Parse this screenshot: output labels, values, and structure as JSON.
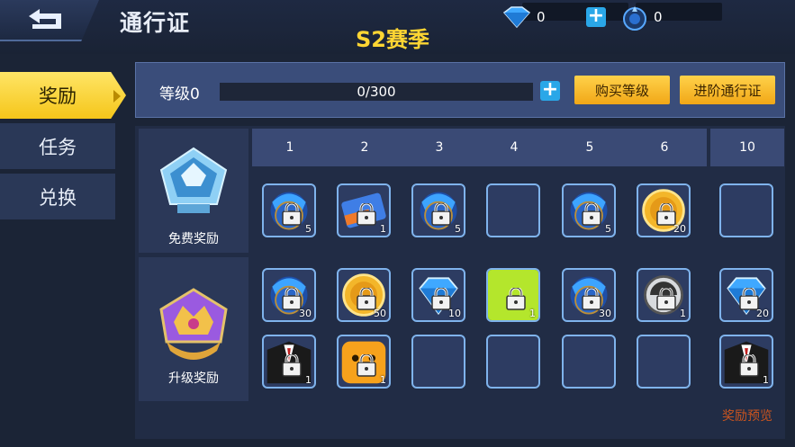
{
  "header": {
    "title": "通行证",
    "season": "S2赛季",
    "currency_diamond": "0",
    "currency_token": "0"
  },
  "sidebar": {
    "items": [
      {
        "label": "奖励",
        "active": true
      },
      {
        "label": "任务",
        "active": false
      },
      {
        "label": "兑换",
        "active": false
      }
    ]
  },
  "level": {
    "label": "等级0",
    "progress_text": "0/300",
    "progress": 0,
    "buy_label": "购买等级",
    "upgrade_label": "进阶通行证"
  },
  "columns": [
    "1",
    "2",
    "3",
    "4",
    "5",
    "6",
    "10"
  ],
  "rows": {
    "free_label": "免费奖励",
    "upgrade_label": "升级奖励"
  },
  "free_rewards": [
    {
      "icon": "blue-pet-icon",
      "count": "5"
    },
    {
      "icon": "ticket-icon",
      "count": "1"
    },
    {
      "icon": "blue-pet-icon",
      "count": "5"
    },
    {
      "icon": "empty",
      "count": ""
    },
    {
      "icon": "blue-pet-icon",
      "count": "5"
    },
    {
      "icon": "gold-coin-icon",
      "count": "20"
    },
    {
      "icon": "empty",
      "count": ""
    }
  ],
  "upgrade_rewards_row1": [
    {
      "icon": "blue-pet-icon",
      "count": "30"
    },
    {
      "icon": "gold-coin-icon",
      "count": "50"
    },
    {
      "icon": "diamond-icon",
      "count": "10"
    },
    {
      "icon": "green-card-icon",
      "count": "1"
    },
    {
      "icon": "blue-pet-icon",
      "count": "30"
    },
    {
      "icon": "grey-badge-icon",
      "count": "1"
    },
    {
      "icon": "diamond-icon",
      "count": "20"
    }
  ],
  "upgrade_rewards_row2": [
    {
      "icon": "suit-icon",
      "count": "1"
    },
    {
      "icon": "orange-character-icon",
      "count": "1"
    },
    {
      "icon": "empty",
      "count": ""
    },
    {
      "icon": "empty",
      "count": ""
    },
    {
      "icon": "empty",
      "count": ""
    },
    {
      "icon": "empty",
      "count": ""
    },
    {
      "icon": "suit-icon",
      "count": "1"
    }
  ],
  "footer": {
    "preview_label": "奖励预览"
  },
  "colors": {
    "accent_yellow": "#ffd633",
    "slot_border": "#7fb3ec",
    "preview_orange": "#c9541f"
  }
}
